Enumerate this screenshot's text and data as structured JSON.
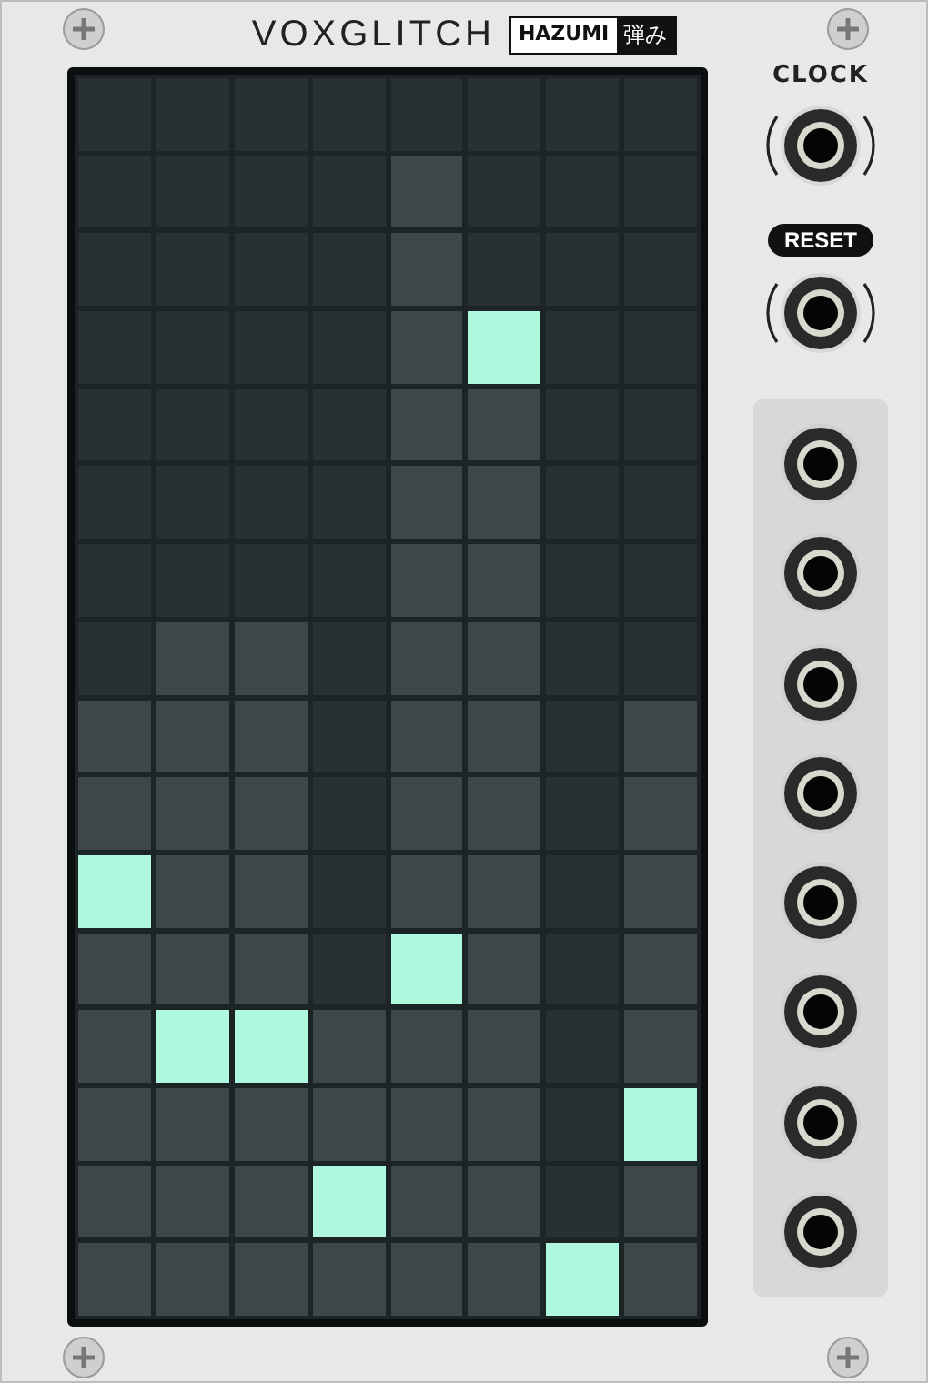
{
  "brand": "VOXGLITCH",
  "module": {
    "name": "HAZUMI",
    "name_jp": "弾み"
  },
  "grid": {
    "rows": [
      {
        "cells": [
          {
            "kind": "off"
          },
          {
            "kind": "off"
          },
          {
            "kind": "off"
          },
          {
            "kind": "off"
          },
          {
            "kind": "off"
          },
          {
            "kind": "off"
          },
          {
            "kind": "off"
          },
          {
            "kind": "off"
          }
        ]
      },
      {
        "cells": [
          {
            "kind": "off"
          },
          {
            "kind": "off"
          },
          {
            "kind": "off"
          },
          {
            "kind": "off"
          },
          {
            "kind": "lit"
          },
          {
            "kind": "off"
          },
          {
            "kind": "off"
          },
          {
            "kind": "off"
          }
        ]
      },
      {
        "cells": [
          {
            "kind": "off"
          },
          {
            "kind": "off"
          },
          {
            "kind": "off"
          },
          {
            "kind": "off"
          },
          {
            "kind": "lit"
          },
          {
            "kind": "off"
          },
          {
            "kind": "off"
          },
          {
            "kind": "off"
          }
        ]
      },
      {
        "cells": [
          {
            "kind": "off"
          },
          {
            "kind": "off"
          },
          {
            "kind": "off"
          },
          {
            "kind": "off"
          },
          {
            "kind": "lit"
          },
          {
            "kind": "ball"
          },
          {
            "kind": "off"
          },
          {
            "kind": "off"
          }
        ]
      },
      {
        "cells": [
          {
            "kind": "off"
          },
          {
            "kind": "off"
          },
          {
            "kind": "off"
          },
          {
            "kind": "off"
          },
          {
            "kind": "lit"
          },
          {
            "kind": "lit"
          },
          {
            "kind": "off"
          },
          {
            "kind": "off"
          }
        ]
      },
      {
        "cells": [
          {
            "kind": "off"
          },
          {
            "kind": "off"
          },
          {
            "kind": "off"
          },
          {
            "kind": "off"
          },
          {
            "kind": "lit"
          },
          {
            "kind": "lit"
          },
          {
            "kind": "off"
          },
          {
            "kind": "off"
          }
        ]
      },
      {
        "cells": [
          {
            "kind": "off"
          },
          {
            "kind": "off"
          },
          {
            "kind": "off"
          },
          {
            "kind": "off"
          },
          {
            "kind": "lit"
          },
          {
            "kind": "lit"
          },
          {
            "kind": "off"
          },
          {
            "kind": "off"
          }
        ]
      },
      {
        "cells": [
          {
            "kind": "off"
          },
          {
            "kind": "lit"
          },
          {
            "kind": "lit"
          },
          {
            "kind": "off"
          },
          {
            "kind": "lit"
          },
          {
            "kind": "lit"
          },
          {
            "kind": "off"
          },
          {
            "kind": "off"
          }
        ]
      },
      {
        "cells": [
          {
            "kind": "lit"
          },
          {
            "kind": "lit"
          },
          {
            "kind": "lit"
          },
          {
            "kind": "off"
          },
          {
            "kind": "lit"
          },
          {
            "kind": "lit"
          },
          {
            "kind": "off"
          },
          {
            "kind": "lit"
          }
        ]
      },
      {
        "cells": [
          {
            "kind": "lit"
          },
          {
            "kind": "lit"
          },
          {
            "kind": "lit"
          },
          {
            "kind": "off"
          },
          {
            "kind": "lit"
          },
          {
            "kind": "lit"
          },
          {
            "kind": "off"
          },
          {
            "kind": "lit"
          }
        ]
      },
      {
        "cells": [
          {
            "kind": "ball"
          },
          {
            "kind": "lit"
          },
          {
            "kind": "lit"
          },
          {
            "kind": "off"
          },
          {
            "kind": "lit"
          },
          {
            "kind": "lit"
          },
          {
            "kind": "off"
          },
          {
            "kind": "lit"
          }
        ]
      },
      {
        "cells": [
          {
            "kind": "lit"
          },
          {
            "kind": "lit"
          },
          {
            "kind": "lit"
          },
          {
            "kind": "off"
          },
          {
            "kind": "ball"
          },
          {
            "kind": "lit"
          },
          {
            "kind": "off"
          },
          {
            "kind": "lit"
          }
        ]
      },
      {
        "cells": [
          {
            "kind": "lit"
          },
          {
            "kind": "ball"
          },
          {
            "kind": "ball"
          },
          {
            "kind": "lit"
          },
          {
            "kind": "lit"
          },
          {
            "kind": "lit"
          },
          {
            "kind": "off"
          },
          {
            "kind": "lit"
          }
        ]
      },
      {
        "cells": [
          {
            "kind": "lit"
          },
          {
            "kind": "lit"
          },
          {
            "kind": "lit"
          },
          {
            "kind": "lit"
          },
          {
            "kind": "lit"
          },
          {
            "kind": "lit"
          },
          {
            "kind": "off"
          },
          {
            "kind": "ball"
          }
        ]
      },
      {
        "cells": [
          {
            "kind": "lit"
          },
          {
            "kind": "lit"
          },
          {
            "kind": "lit"
          },
          {
            "kind": "ball"
          },
          {
            "kind": "lit"
          },
          {
            "kind": "lit"
          },
          {
            "kind": "off"
          },
          {
            "kind": "lit"
          }
        ]
      },
      {
        "cells": [
          {
            "kind": "lit"
          },
          {
            "kind": "lit"
          },
          {
            "kind": "lit"
          },
          {
            "kind": "lit"
          },
          {
            "kind": "lit"
          },
          {
            "kind": "lit"
          },
          {
            "kind": "ball"
          },
          {
            "kind": "lit"
          }
        ]
      }
    ]
  },
  "inputs": [
    {
      "label": "CLOCK",
      "kind": "plain"
    },
    {
      "label": "RESET",
      "kind": "pill"
    }
  ]
}
